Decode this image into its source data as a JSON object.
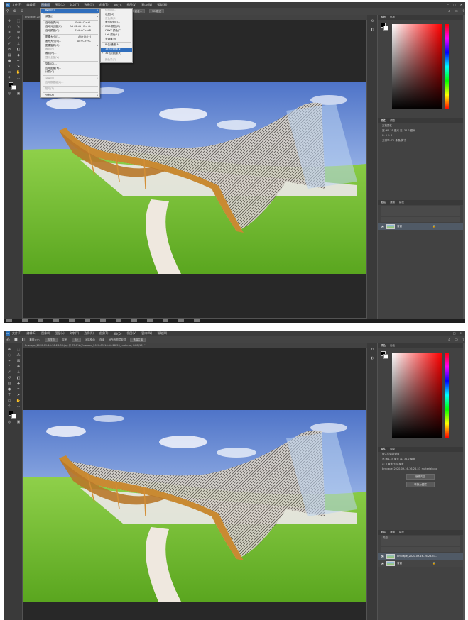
{
  "shot1": {
    "menu": [
      "文件(F)",
      "编辑(E)",
      "图像(I)",
      "图层(L)",
      "文字(Y)",
      "选择(S)",
      "滤镜(T)",
      "3D(D)",
      "视图(V)",
      "窗口(W)",
      "帮助(H)"
    ],
    "active_menu": "图像(I)",
    "tab": "Enscape_2020-09-16-16-28-53.jpg @ 75.1% (RGB/8#) *",
    "image_menu": [
      {
        "label": "模式(M)",
        "shortcut": "",
        "submenu": true,
        "highlight": true
      },
      {
        "sep": true
      },
      {
        "label": "调整(J)",
        "shortcut": "",
        "submenu": true
      },
      {
        "sep": true
      },
      {
        "label": "自动色调(N)",
        "shortcut": "Shift+Ctrl+L"
      },
      {
        "label": "自动对比度(U)",
        "shortcut": "Alt+Shift+Ctrl+L"
      },
      {
        "label": "自动颜色(O)",
        "shortcut": "Shift+Ctrl+B"
      },
      {
        "sep": true
      },
      {
        "label": "图像大小(I)...",
        "shortcut": "Alt+Ctrl+I"
      },
      {
        "label": "画布大小(S)...",
        "shortcut": "Alt+Ctrl+C"
      },
      {
        "label": "图像旋转(G)",
        "shortcut": "",
        "submenu": true
      },
      {
        "label": "裁剪(P)",
        "shortcut": "",
        "disabled": true
      },
      {
        "label": "裁切(R)...",
        "shortcut": ""
      },
      {
        "label": "显示全部(V)",
        "shortcut": "",
        "disabled": true
      },
      {
        "sep": true
      },
      {
        "label": "复制(D)...",
        "shortcut": ""
      },
      {
        "label": "应用图像(Y)...",
        "shortcut": ""
      },
      {
        "label": "计算(C)...",
        "shortcut": ""
      },
      {
        "sep": true
      },
      {
        "label": "变量(B)",
        "shortcut": "",
        "submenu": true,
        "disabled": true
      },
      {
        "label": "应用数据组(L)...",
        "shortcut": "",
        "disabled": true
      },
      {
        "sep": true
      },
      {
        "label": "陷印(T)...",
        "shortcut": "",
        "disabled": true
      },
      {
        "sep": true
      },
      {
        "label": "分析(A)",
        "shortcut": "",
        "submenu": true
      }
    ],
    "mode_menu": [
      {
        "label": "位图(B)...",
        "disabled": true
      },
      {
        "label": "灰度(G)"
      },
      {
        "label": "双色调(D)",
        "disabled": true
      },
      {
        "label": "索引颜色(I)..."
      },
      {
        "label": "RGB 颜色(R)",
        "checked": true
      },
      {
        "label": "CMYK 颜色(C)"
      },
      {
        "label": "Lab 颜色(L)"
      },
      {
        "label": "多通道(M)"
      },
      {
        "sep": true
      },
      {
        "label": "8 位/通道(A)",
        "checked": false
      },
      {
        "label": "16 位/通道(N)",
        "highlight": true
      },
      {
        "label": "32 位/通道(H)",
        "checked": true
      },
      {
        "sep": true
      },
      {
        "label": "颜色表(T)...",
        "disabled": true
      }
    ],
    "options": {
      "btn1": "选择并遮住...",
      "btn2": "3D 模式"
    },
    "panel_tabs_color": [
      "颜色",
      "色板"
    ],
    "panel_tabs_props": [
      "属性",
      "调整"
    ],
    "props": [
      "文档属性",
      "宽: 64.35 厘米    高: 36.2 厘米",
      "X: 0             Y: 0",
      "分辨率: 72 像素/英寸"
    ],
    "panel_tabs_layers": [
      "图层",
      "通道",
      "路径"
    ],
    "layer_name": "背景"
  },
  "shot2": {
    "menu": [
      "文件(F)",
      "编辑(E)",
      "图像(I)",
      "图层(L)",
      "文字(Y)",
      "选择(S)",
      "滤镜(T)",
      "3D(D)",
      "视图(V)",
      "窗口(W)",
      "帮助(H)"
    ],
    "tab": "Enscape_2020-09-16-16-28-53.jpg @ 75.1% (Enscape_2020-09-16-16-28-53_material, RGB/16) *",
    "options": {
      "f1": "取样大小:",
      "v1": "取样点",
      "f2": "容差:",
      "v2": "32",
      "c1": "消除锯齿",
      "c2": "连续",
      "c3": "对所有图层取样",
      "btn": "选择主体"
    },
    "panel_tabs_color": [
      "颜色",
      "色板"
    ],
    "panel_tabs_props": [
      "属性",
      "调整"
    ],
    "props": [
      "嵌入的智能对象",
      "宽: 64.35 厘米    高: 36.2 厘米",
      "X: 0 厘米        Y: 0 厘米",
      "Enscape_2020-09-16-16-28-53_material.png",
      "编辑内容",
      "转换为图层"
    ],
    "panel_tabs_layers": [
      "图层",
      "通道",
      "路径"
    ],
    "layer_filter": "类型",
    "layer_name1": "Enscape_2020-09-16-16-28-53...",
    "layer_name2": "背景"
  }
}
